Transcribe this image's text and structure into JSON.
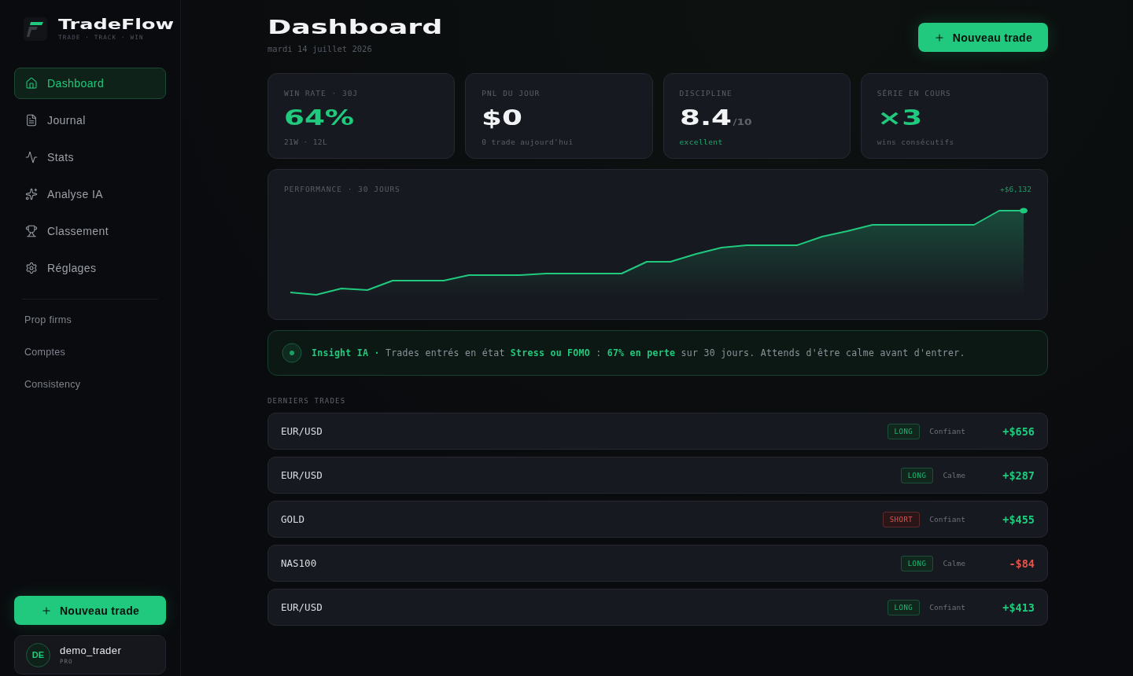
{
  "brand": {
    "name": "TradeFlow",
    "tagline": "TRADE · TRACK · WIN"
  },
  "nav": [
    {
      "label": "Dashboard",
      "kind": "home",
      "selected": true
    },
    {
      "label": "Journal",
      "kind": "journal",
      "selected": false
    },
    {
      "label": "Stats",
      "kind": "stats",
      "selected": false
    },
    {
      "label": "Analyse IA",
      "kind": "ai",
      "selected": false
    },
    {
      "label": "Classement",
      "kind": "ranking",
      "selected": false
    },
    {
      "label": "Réglages",
      "kind": "settings",
      "selected": false
    }
  ],
  "links": [
    "Prop firms",
    "Comptes",
    "Consistency"
  ],
  "sidebar_button": "Nouveau trade",
  "user": {
    "initials": "DE",
    "name": "demo_trader",
    "plan": "PRO"
  },
  "header": {
    "title": "Dashboard",
    "date": "mardi 14 juillet 2026",
    "button": "Nouveau trade"
  },
  "stats": [
    {
      "label": "WIN RATE · 30J",
      "value": "64%",
      "value_accent": true,
      "sub": "21W · 12L",
      "sub_accent": false
    },
    {
      "label": "PNL DU JOUR",
      "value": "$0",
      "value_accent": false,
      "sub": "0 trade aujourd'hui",
      "sub_accent": false
    },
    {
      "label": "DISCIPLINE",
      "value": "8.4",
      "suffix": "/10",
      "value_accent": false,
      "sub": "excellent",
      "sub_accent": true
    },
    {
      "label": "SÉRIE EN COURS",
      "value": "×3",
      "value_accent": true,
      "sub": "wins consécutifs",
      "sub_accent": false
    }
  ],
  "performance": {
    "title": "PERFORMANCE · 30 JOURS",
    "total": "+$6,132"
  },
  "insight": {
    "text": "**Insight IA ·** Trades entrés en état **Stress ou FOMO** : **67% en perte** sur 30 jours. Attends d'être calme avant d'entrer."
  },
  "trades_title": "DERNIERS TRADES",
  "trades": [
    {
      "pair": "EUR/USD",
      "side": {
        "label": "LONG",
        "kind": "long"
      },
      "mood": "Confiant",
      "pnl": {
        "label": "+$656",
        "kind": "gain"
      }
    },
    {
      "pair": "EUR/USD",
      "side": {
        "label": "LONG",
        "kind": "long"
      },
      "mood": "Calme",
      "pnl": {
        "label": "+$287",
        "kind": "gain"
      }
    },
    {
      "pair": "GOLD",
      "side": {
        "label": "SHORT",
        "kind": "short"
      },
      "mood": "Confiant",
      "pnl": {
        "label": "+$455",
        "kind": "gain"
      }
    },
    {
      "pair": "NAS100",
      "side": {
        "label": "LONG",
        "kind": "long"
      },
      "mood": "Calme",
      "pnl": {
        "label": "-$84",
        "kind": "loss"
      }
    },
    {
      "pair": "EUR/USD",
      "side": {
        "label": "LONG",
        "kind": "long"
      },
      "mood": "Confiant",
      "pnl": {
        "label": "+$413",
        "kind": "gain"
      }
    }
  ]
}
